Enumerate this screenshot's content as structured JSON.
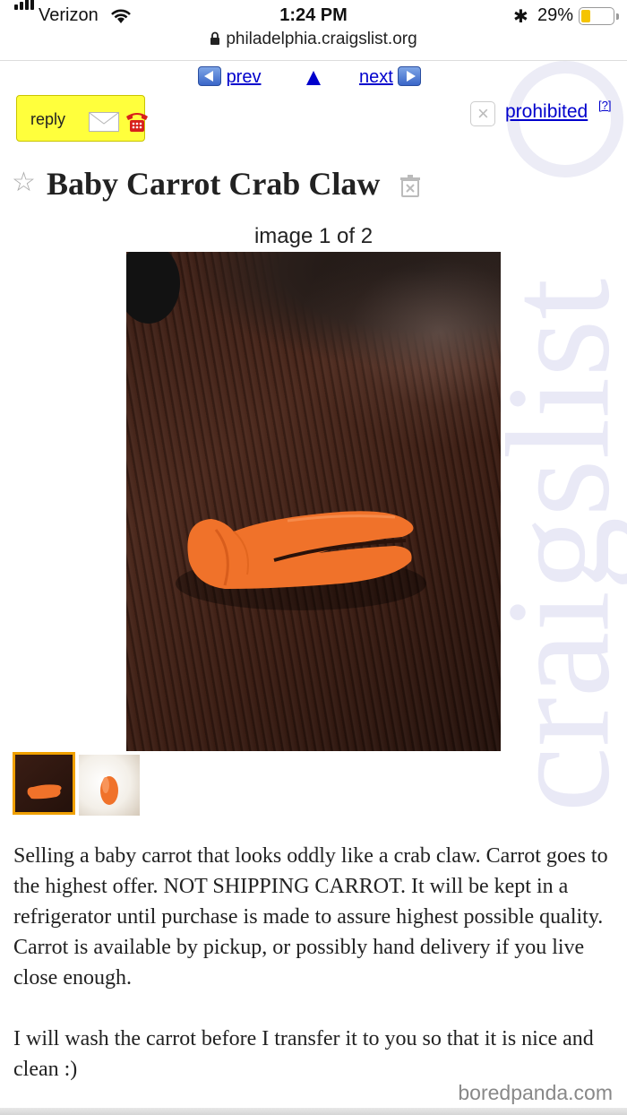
{
  "status_bar": {
    "carrier": "Verizon",
    "time": "1:24 PM",
    "bluetooth": "✱",
    "battery_percent": "29%",
    "battery_level": 0.29
  },
  "browser": {
    "url": "philadelphia.craigslist.org"
  },
  "watermark": {
    "text": "craigslist"
  },
  "nav": {
    "prev_label": "prev",
    "next_label": "next",
    "up_label": "▲"
  },
  "actions": {
    "reply_label": "reply",
    "prohibited_label": "prohibited",
    "prohibited_help": "[?]"
  },
  "posting": {
    "title": "Baby Carrot Crab Claw",
    "image_counter": "image 1 of 2",
    "body": [
      "Selling a baby carrot that looks oddly like a crab claw. Carrot goes to the highest offer. NOT SHIPPING CARROT. It will be kept in a refrigerator until purchase is made to assure highest possible quality. Carrot is available by pickup, or possibly hand delivery if you live close enough.",
      "I will wash the carrot before I transfer it to you so that it is nice and clean :)"
    ]
  },
  "credit": "boredpanda.com",
  "colors": {
    "link": "#0000cc",
    "reply_bg": "#ffff3c",
    "carrot": "#f0722a",
    "thumb_selected": "#f0a000"
  }
}
